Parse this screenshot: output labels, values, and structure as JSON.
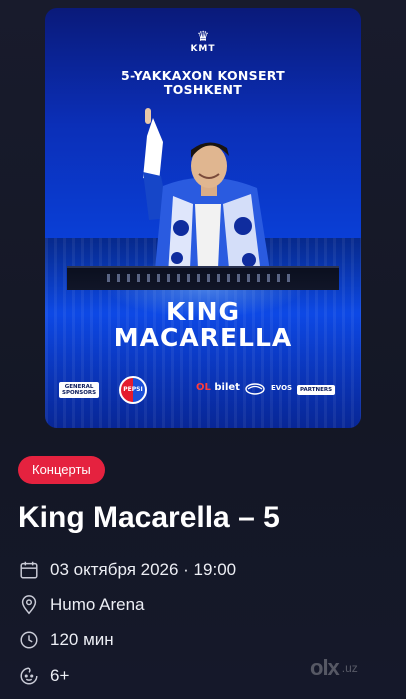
{
  "poster": {
    "brand": "KMT",
    "headline_line1": "5-YAKKAXON KONSERT",
    "headline_line2": "TOSHKENT",
    "artist_line1": "KING",
    "artist_line2": "MACARELLA",
    "sponsors": {
      "general_label_line1": "GENERAL",
      "general_label_line2": "SPONSORS",
      "pepsi": "PEPSI",
      "bilet_prefix": "OL",
      "bilet_suffix": "bilet",
      "evos": "EVOS",
      "partners_label": "PARTNERS"
    },
    "colors": {
      "poster_blue": "#0a3fd6",
      "bilet_red": "#ff3a3a"
    }
  },
  "event": {
    "category": "Концерты",
    "title": "King Macarella – 5",
    "datetime": "03 октября 2026 · 19:00",
    "venue": "Humo Arena",
    "duration": "120 мин",
    "age_rating": "6+"
  },
  "icons": {
    "date": "calendar-icon",
    "venue": "location-pin-icon",
    "duration": "clock-icon",
    "age": "age-rating-icon"
  },
  "watermark": {
    "brand": "olx",
    "domain": ".uz"
  },
  "colors": {
    "background": "#151827",
    "accent": "#e5223f",
    "text": "#ffffff",
    "muted": "#c9cbd6"
  }
}
